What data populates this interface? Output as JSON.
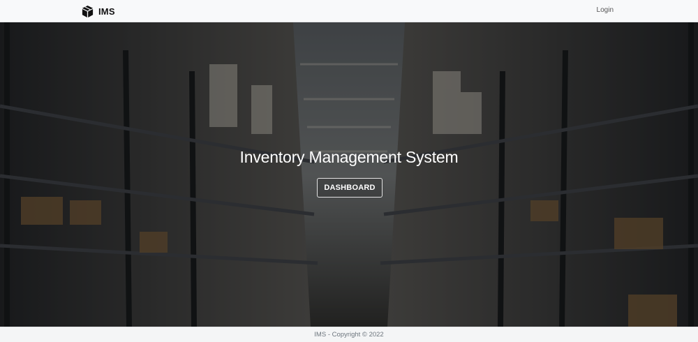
{
  "navbar": {
    "brand": "IMS",
    "brand_icon": "box-icon",
    "login_label": "Login"
  },
  "hero": {
    "title": "Inventory Management System",
    "button_label": "DASHBOARD",
    "background": "warehouse-aisle-photo"
  },
  "footer": {
    "text": "IMS - Copyright © 2022"
  },
  "colors": {
    "navbar_bg": "#f8f9fa",
    "hero_text": "#ffffff",
    "footer_text": "#6c757d"
  }
}
